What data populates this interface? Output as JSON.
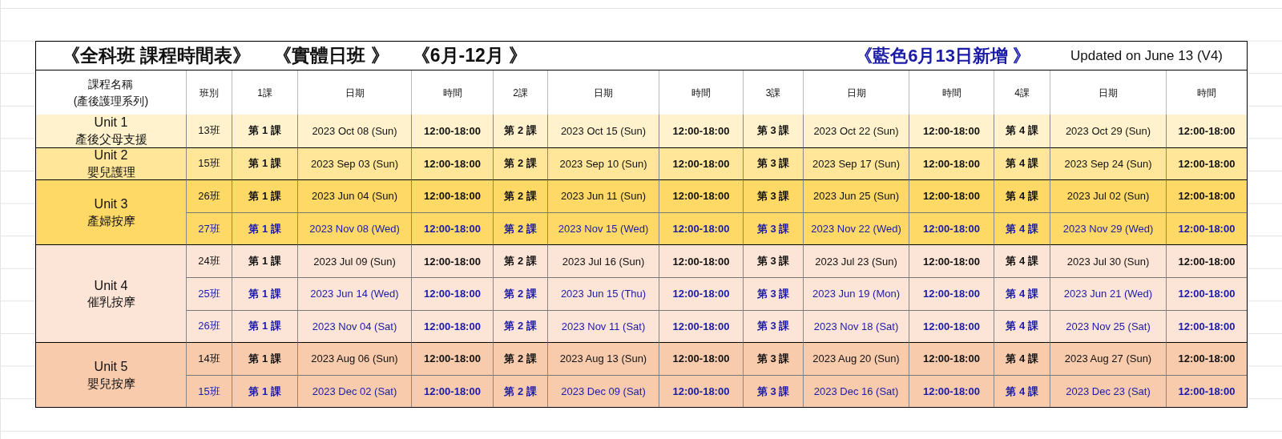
{
  "title_row": {
    "title": "《全科班 課程時間表》",
    "mode": "《實體日班 》",
    "period": "《6月-12月 》",
    "note": "《藍色6月13日新增 》",
    "updated": "Updated on June 13 (V4)"
  },
  "table": {
    "columns": [
      "課程名稱\n(產後護理系列)",
      "班別",
      "1課",
      "日期",
      "時間",
      "2課",
      "日期",
      "時間",
      "3課",
      "日期",
      "時間",
      "4課",
      "日期",
      "時間"
    ],
    "units": [
      {
        "name": "Unit 1",
        "subtitle": "產後父母支援",
        "color": "#fff2cc",
        "classes": [
          {
            "class": "13班",
            "new": false,
            "cells": [
              "第 1 課",
              "2023 Oct 08 (Sun)",
              "12:00-18:00",
              "第 2 課",
              "2023 Oct 15 (Sun)",
              "12:00-18:00",
              "第 3 課",
              "2023 Oct 22 (Sun)",
              "12:00-18:00",
              "第 4 課",
              "2023 Oct 29 (Sun)",
              "12:00-18:00"
            ]
          }
        ]
      },
      {
        "name": "Unit 2",
        "subtitle": "嬰兒護理",
        "color": "#ffe699",
        "classes": [
          {
            "class": "15班",
            "new": false,
            "cells": [
              "第 1 課",
              "2023 Sep 03 (Sun)",
              "12:00-18:00",
              "第 2 課",
              "2023 Sep 10 (Sun)",
              "12:00-18:00",
              "第 3 課",
              "2023 Sep 17 (Sun)",
              "12:00-18:00",
              "第 4 課",
              "2023 Sep 24 (Sun)",
              "12:00-18:00"
            ]
          }
        ]
      },
      {
        "name": "Unit 3",
        "subtitle": "產婦按摩",
        "color": "#ffd966",
        "classes": [
          {
            "class": "26班",
            "new": false,
            "cells": [
              "第 1 課",
              "2023 Jun 04 (Sun)",
              "12:00-18:00",
              "第 2 課",
              "2023 Jun 11 (Sun)",
              "12:00-18:00",
              "第 3 課",
              "2023 Jun 25 (Sun)",
              "12:00-18:00",
              "第 4 課",
              "2023 Jul 02 (Sun)",
              "12:00-18:00"
            ]
          },
          {
            "class": "27班",
            "new": true,
            "cells": [
              "第 1 課",
              "2023 Nov 08 (Wed)",
              "12:00-18:00",
              "第 2 課",
              "2023 Nov 15 (Wed)",
              "12:00-18:00",
              "第 3 課",
              "2023 Nov 22 (Wed)",
              "12:00-18:00",
              "第 4 課",
              "2023 Nov 29 (Wed)",
              "12:00-18:00"
            ]
          }
        ]
      },
      {
        "name": "Unit 4",
        "subtitle": "催乳按摩",
        "color": "#fce4d6",
        "classes": [
          {
            "class": "24班",
            "new": false,
            "cells": [
              "第 1 課",
              "2023 Jul 09 (Sun)",
              "12:00-18:00",
              "第 2 課",
              "2023 Jul 16 (Sun)",
              "12:00-18:00",
              "第 3 課",
              "2023 Jul 23 (Sun)",
              "12:00-18:00",
              "第 4 課",
              "2023 Jul 30 (Sun)",
              "12:00-18:00"
            ]
          },
          {
            "class": "25班",
            "new": true,
            "cells": [
              "第 1 課",
              "2023 Jun 14 (Wed)",
              "12:00-18:00",
              "第 2 課",
              "2023 Jun 15 (Thu)",
              "12:00-18:00",
              "第 3 課",
              "2023 Jun 19 (Mon)",
              "12:00-18:00",
              "第 4 課",
              "2023 Jun 21 (Wed)",
              "12:00-18:00"
            ]
          },
          {
            "class": "26班",
            "new": true,
            "cells": [
              "第 1 課",
              "2023 Nov 04 (Sat)",
              "12:00-18:00",
              "第 2 課",
              "2023 Nov 11 (Sat)",
              "12:00-18:00",
              "第 3 課",
              "2023 Nov 18 (Sat)",
              "12:00-18:00",
              "第 4 課",
              "2023 Nov 25 (Sat)",
              "12:00-18:00"
            ]
          }
        ]
      },
      {
        "name": "Unit 5",
        "subtitle": "嬰兒按摩",
        "color": "#f8cbad",
        "classes": [
          {
            "class": "14班",
            "new": false,
            "cells": [
              "第 1 課",
              "2023 Aug 06 (Sun)",
              "12:00-18:00",
              "第 2 課",
              "2023 Aug 13 (Sun)",
              "12:00-18:00",
              "第 3 課",
              "2023 Aug 20 (Sun)",
              "12:00-18:00",
              "第 4 課",
              "2023 Aug 27 (Sun)",
              "12:00-18:00"
            ]
          },
          {
            "class": "15班",
            "new": true,
            "cells": [
              "第 1 課",
              "2023 Dec 02 (Sat)",
              "12:00-18:00",
              "第 2 課",
              "2023 Dec 09 (Sat)",
              "12:00-18:00",
              "第 3 課",
              "2023 Dec 16 (Sat)",
              "12:00-18:00",
              "第 4 課",
              "2023 Dec 23 (Sat)",
              "12:00-18:00"
            ]
          }
        ]
      }
    ]
  }
}
